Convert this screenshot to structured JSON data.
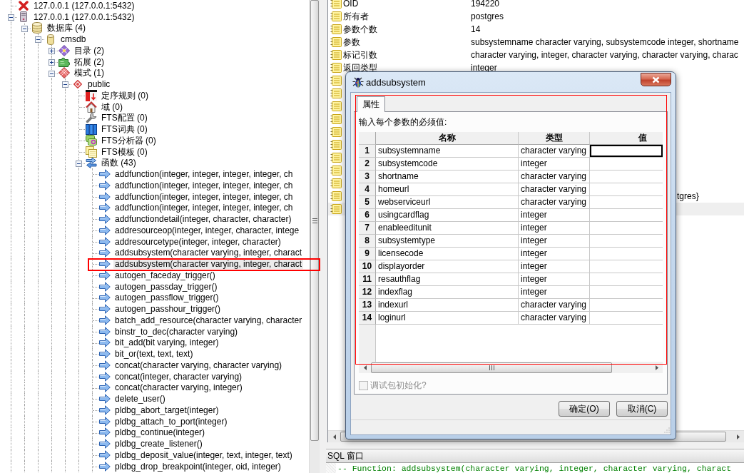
{
  "object_tree": {
    "items": [
      {
        "kind": "server_down",
        "label": "127.0.0.1 (127.0.0.1:5432)",
        "selected": false
      },
      {
        "kind": "server",
        "label": "127.0.0.1 (127.0.0.1:5432)",
        "expanded": true,
        "selected": false,
        "children": [
          {
            "kind": "databases",
            "label": "数据库 (4)",
            "expanded": true,
            "selected": false,
            "children": [
              {
                "kind": "database",
                "label": "cmsdb",
                "expanded": true,
                "selected": false,
                "children": [
                  {
                    "kind": "catalogs",
                    "label": "目录 (2)",
                    "expanded": false,
                    "selected": false
                  },
                  {
                    "kind": "extensions",
                    "label": "拓展 (2)",
                    "expanded": false,
                    "selected": false
                  },
                  {
                    "kind": "schemas",
                    "label": "模式 (1)",
                    "expanded": true,
                    "selected": false,
                    "children": [
                      {
                        "kind": "schema",
                        "label": "public",
                        "expanded": true,
                        "selected": false,
                        "children": [
                          {
                            "kind": "collations",
                            "label": "定序规则 (0)",
                            "selected": false
                          },
                          {
                            "kind": "domains",
                            "label": "域 (0)",
                            "selected": false
                          },
                          {
                            "kind": "fts_configurations",
                            "label": "FTS配置 (0)",
                            "selected": false
                          },
                          {
                            "kind": "fts_dictionaries",
                            "label": "FTS词典 (0)",
                            "selected": false
                          },
                          {
                            "kind": "fts_parsers",
                            "label": "FTS分析器 (0)",
                            "selected": false
                          },
                          {
                            "kind": "fts_templates",
                            "label": "FTS模板 (0)",
                            "selected": false
                          },
                          {
                            "kind": "functions",
                            "label": "函数 (43)",
                            "expanded": true,
                            "selected": false,
                            "children": [
                              {
                                "kind": "function",
                                "label": "addfunction(integer, integer, integer, integer, ch",
                                "selected": false,
                                "highlighted": false
                              },
                              {
                                "kind": "function",
                                "label": "addfunction(integer, integer, integer, integer, ch",
                                "selected": false,
                                "highlighted": false
                              },
                              {
                                "kind": "function",
                                "label": "addfunction(integer, integer, integer, integer, ch",
                                "selected": false,
                                "highlighted": false
                              },
                              {
                                "kind": "function",
                                "label": "addfunction(integer, integer, integer, integer, ch",
                                "selected": false,
                                "highlighted": false
                              },
                              {
                                "kind": "function",
                                "label": "addfunctiondetail(integer, character, character)",
                                "selected": false,
                                "highlighted": false
                              },
                              {
                                "kind": "function",
                                "label": "addresourceop(integer, integer, character, intege",
                                "selected": false,
                                "highlighted": false
                              },
                              {
                                "kind": "function",
                                "label": "addresourcetype(integer, integer, character)",
                                "selected": false,
                                "highlighted": false
                              },
                              {
                                "kind": "function",
                                "label": "addsubsystem(character varying, integer, charact",
                                "selected": false,
                                "highlighted": false
                              },
                              {
                                "kind": "function",
                                "label": "addsubsystem(character varying, integer, charact",
                                "selected": true,
                                "highlighted": true
                              },
                              {
                                "kind": "function",
                                "label": "autogen_faceday_trigger()",
                                "selected": false,
                                "highlighted": false
                              },
                              {
                                "kind": "function",
                                "label": "autogen_passday_trigger()",
                                "selected": false,
                                "highlighted": false
                              },
                              {
                                "kind": "function",
                                "label": "autogen_passflow_trigger()",
                                "selected": false,
                                "highlighted": false
                              },
                              {
                                "kind": "function",
                                "label": "autogen_passhour_trigger()",
                                "selected": false,
                                "highlighted": false
                              },
                              {
                                "kind": "function",
                                "label": "batch_add_resource(character varying, character",
                                "selected": false,
                                "highlighted": false
                              },
                              {
                                "kind": "function",
                                "label": "binstr_to_dec(character varying)",
                                "selected": false,
                                "highlighted": false
                              },
                              {
                                "kind": "function",
                                "label": "bit_add(bit varying, integer)",
                                "selected": false,
                                "highlighted": false
                              },
                              {
                                "kind": "function",
                                "label": "bit_or(text, text, text)",
                                "selected": false,
                                "highlighted": false
                              },
                              {
                                "kind": "function",
                                "label": "concat(character varying, character varying)",
                                "selected": false,
                                "highlighted": false
                              },
                              {
                                "kind": "function",
                                "label": "concat(integer, character varying)",
                                "selected": false,
                                "highlighted": false
                              },
                              {
                                "kind": "function",
                                "label": "concat(character varying, integer)",
                                "selected": false,
                                "highlighted": false
                              },
                              {
                                "kind": "function",
                                "label": "delete_user()",
                                "selected": false,
                                "highlighted": false
                              },
                              {
                                "kind": "function",
                                "label": "pldbg_abort_target(integer)",
                                "selected": false,
                                "highlighted": false
                              },
                              {
                                "kind": "function",
                                "label": "pldbg_attach_to_port(integer)",
                                "selected": false,
                                "highlighted": false
                              },
                              {
                                "kind": "function",
                                "label": "pldbg_continue(integer)",
                                "selected": false,
                                "highlighted": false
                              },
                              {
                                "kind": "function",
                                "label": "pldbg_create_listener()",
                                "selected": false,
                                "highlighted": false
                              },
                              {
                                "kind": "function",
                                "label": "pldbg_deposit_value(integer, text, integer, text)",
                                "selected": false,
                                "highlighted": false
                              },
                              {
                                "kind": "function",
                                "label": "pldbg_drop_breakpoint(integer, oid, integer)",
                                "selected": false,
                                "highlighted": false
                              }
                            ]
                          }
                        ]
                      }
                    ]
                  }
                ]
              }
            ]
          }
        ]
      }
    ]
  },
  "properties": {
    "rows": [
      {
        "name": "OID",
        "value": "194220",
        "selected": false
      },
      {
        "name": "所有者",
        "value": "postgres",
        "selected": false
      },
      {
        "name": "参数个数",
        "value": "14",
        "selected": false
      },
      {
        "name": "参数",
        "value": "subsystemname character varying, subsystemcode integer, shortname",
        "selected": false
      },
      {
        "name": "标记引数",
        "value": "character varying, integer, character varying, character varying, charac",
        "selected": false
      },
      {
        "name": "返回类型",
        "value": "integer",
        "selected": false
      },
      {
        "selected": false
      },
      {
        "selected": false
      },
      {
        "selected": false
      },
      {
        "selected": false
      },
      {
        "selected": false
      },
      {
        "selected": false
      },
      {
        "selected": false
      },
      {
        "selected": false
      },
      {
        "selected": false
      },
      {
        "value": "tgres}",
        "selected": false
      },
      {
        "selected": true
      }
    ]
  },
  "sql_pane": {
    "title": "SQL 窗口",
    "lines": [
      "-- Function: addsubsystem(character varying, integer, character varying, charact"
    ]
  },
  "dialog": {
    "title": "addsubsystem",
    "tabs": [
      {
        "label": "属性",
        "selected": true,
        "highlighted": true
      }
    ],
    "prompt": "输入每个参数的必须值:",
    "grid": {
      "columns": [
        "名称",
        "类型",
        "值"
      ],
      "rows": [
        {
          "number": "1",
          "name": "subsystemname",
          "type": "character varying",
          "active": true
        },
        {
          "number": "2",
          "name": "subsystemcode",
          "type": "integer",
          "active": false
        },
        {
          "number": "3",
          "name": "shortname",
          "type": "character varying",
          "active": false
        },
        {
          "number": "4",
          "name": "homeurl",
          "type": "character varying",
          "active": false
        },
        {
          "number": "5",
          "name": "webserviceurl",
          "type": "character varying",
          "active": false
        },
        {
          "number": "6",
          "name": "usingcardflag",
          "type": "integer",
          "active": false
        },
        {
          "number": "7",
          "name": "enableeditunit",
          "type": "integer",
          "active": false
        },
        {
          "number": "8",
          "name": "subsystemtype",
          "type": "integer",
          "active": false
        },
        {
          "number": "9",
          "name": "licensecode",
          "type": "integer",
          "active": false
        },
        {
          "number": "10",
          "name": "displayorder",
          "type": "integer",
          "active": false
        },
        {
          "number": "11",
          "name": "resauthflag",
          "type": "integer",
          "active": false
        },
        {
          "number": "12",
          "name": "indexflag",
          "type": "integer",
          "active": false
        },
        {
          "number": "13",
          "name": "indexurl",
          "type": "character varying",
          "active": false
        },
        {
          "number": "14",
          "name": "loginurl",
          "type": "character varying",
          "active": false
        }
      ]
    },
    "checkbox": {
      "label": "调试包初始化?",
      "checked": false,
      "disabled": true
    },
    "buttons": [
      "确定(O)",
      "取消(C)"
    ]
  }
}
